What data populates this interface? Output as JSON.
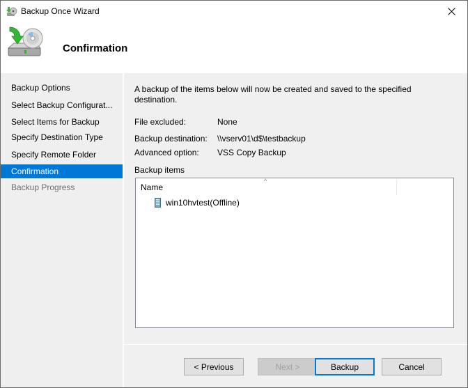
{
  "window": {
    "title": "Backup Once Wizard",
    "close_icon": "close-icon"
  },
  "header": {
    "title": "Confirmation",
    "icon": "backup-drive-icon"
  },
  "sidebar": {
    "items": [
      {
        "label": "Backup Options",
        "state": "normal"
      },
      {
        "label": "Select Backup Configurat...",
        "state": "normal"
      },
      {
        "label": "Select Items for Backup",
        "state": "normal"
      },
      {
        "label": "Specify Destination Type",
        "state": "normal"
      },
      {
        "label": "Specify Remote Folder",
        "state": "normal"
      },
      {
        "label": "Confirmation",
        "state": "active"
      },
      {
        "label": "Backup Progress",
        "state": "disabled"
      }
    ]
  },
  "content": {
    "description": "A backup of the items below will now be created and saved to the specified destination.",
    "fields": [
      {
        "label": "File excluded:",
        "value": "None"
      },
      {
        "label": "Backup destination:",
        "value": "\\\\vserv01\\d$\\testbackup"
      },
      {
        "label": "Advanced option:",
        "value": "VSS Copy Backup"
      }
    ],
    "backup_items_label": "Backup items",
    "list": {
      "column_header": "Name",
      "sort_indicator": "^",
      "items": [
        {
          "name": "win10hvtest(Offline)",
          "icon": "virtual-machine-icon"
        }
      ]
    }
  },
  "footer": {
    "previous_label": "< Previous",
    "next_label": "Next >",
    "backup_label": "Backup",
    "cancel_label": "Cancel"
  },
  "colors": {
    "accent": "#0078d7",
    "panel_bg": "#f0f0f0",
    "disabled_text": "#6d6d6d"
  }
}
